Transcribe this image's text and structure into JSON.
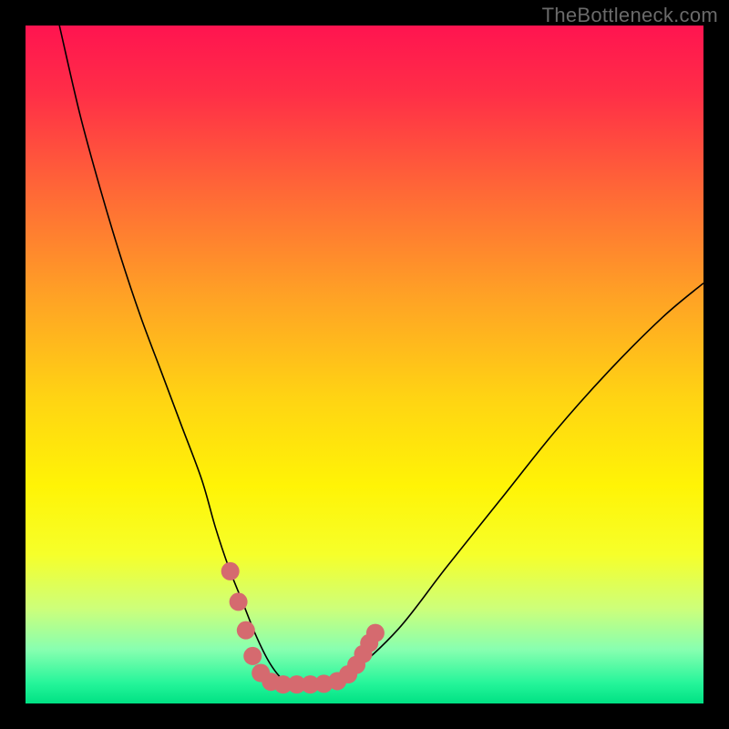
{
  "watermark": {
    "text": "TheBottleneck.com"
  },
  "chart_data": {
    "type": "line",
    "title": "",
    "xlabel": "",
    "ylabel": "",
    "xlim": [
      0,
      100
    ],
    "ylim": [
      0,
      100
    ],
    "background_gradient": {
      "stops": [
        {
          "offset": 0.0,
          "color": "#ff1450"
        },
        {
          "offset": 0.1,
          "color": "#ff2e47"
        },
        {
          "offset": 0.25,
          "color": "#ff6a36"
        },
        {
          "offset": 0.4,
          "color": "#ffa225"
        },
        {
          "offset": 0.55,
          "color": "#ffd413"
        },
        {
          "offset": 0.68,
          "color": "#fff406"
        },
        {
          "offset": 0.78,
          "color": "#f6ff2a"
        },
        {
          "offset": 0.86,
          "color": "#cdff7a"
        },
        {
          "offset": 0.92,
          "color": "#88ffb0"
        },
        {
          "offset": 0.97,
          "color": "#25f59a"
        },
        {
          "offset": 1.0,
          "color": "#00e184"
        }
      ]
    },
    "series": [
      {
        "name": "bottleneck-curve",
        "color": "#000000",
        "stroke_width": 1.6,
        "x": [
          5,
          8,
          11,
          14,
          17,
          20,
          23,
          26,
          28,
          30,
          32,
          34,
          36,
          38,
          40,
          44,
          48,
          55,
          62,
          70,
          78,
          86,
          94,
          100
        ],
        "y": [
          100,
          87,
          76,
          66,
          57,
          49,
          41,
          33,
          26,
          20,
          15,
          10,
          6,
          3.5,
          2.8,
          2.8,
          4.5,
          11,
          20,
          30,
          40,
          49,
          57,
          62
        ]
      }
    ],
    "markers": {
      "name": "trough-markers",
      "color": "#d56a6f",
      "radius": 10,
      "points": [
        {
          "x": 30.2,
          "y": 19.5
        },
        {
          "x": 31.4,
          "y": 15.0
        },
        {
          "x": 32.5,
          "y": 10.8
        },
        {
          "x": 33.5,
          "y": 7.0
        },
        {
          "x": 34.7,
          "y": 4.5
        },
        {
          "x": 36.2,
          "y": 3.2
        },
        {
          "x": 38.0,
          "y": 2.8
        },
        {
          "x": 40.0,
          "y": 2.8
        },
        {
          "x": 42.0,
          "y": 2.8
        },
        {
          "x": 44.0,
          "y": 2.9
        },
        {
          "x": 46.0,
          "y": 3.3
        },
        {
          "x": 47.6,
          "y": 4.3
        },
        {
          "x": 48.8,
          "y": 5.7
        },
        {
          "x": 49.8,
          "y": 7.3
        },
        {
          "x": 50.7,
          "y": 8.9
        },
        {
          "x": 51.6,
          "y": 10.4
        }
      ]
    }
  }
}
